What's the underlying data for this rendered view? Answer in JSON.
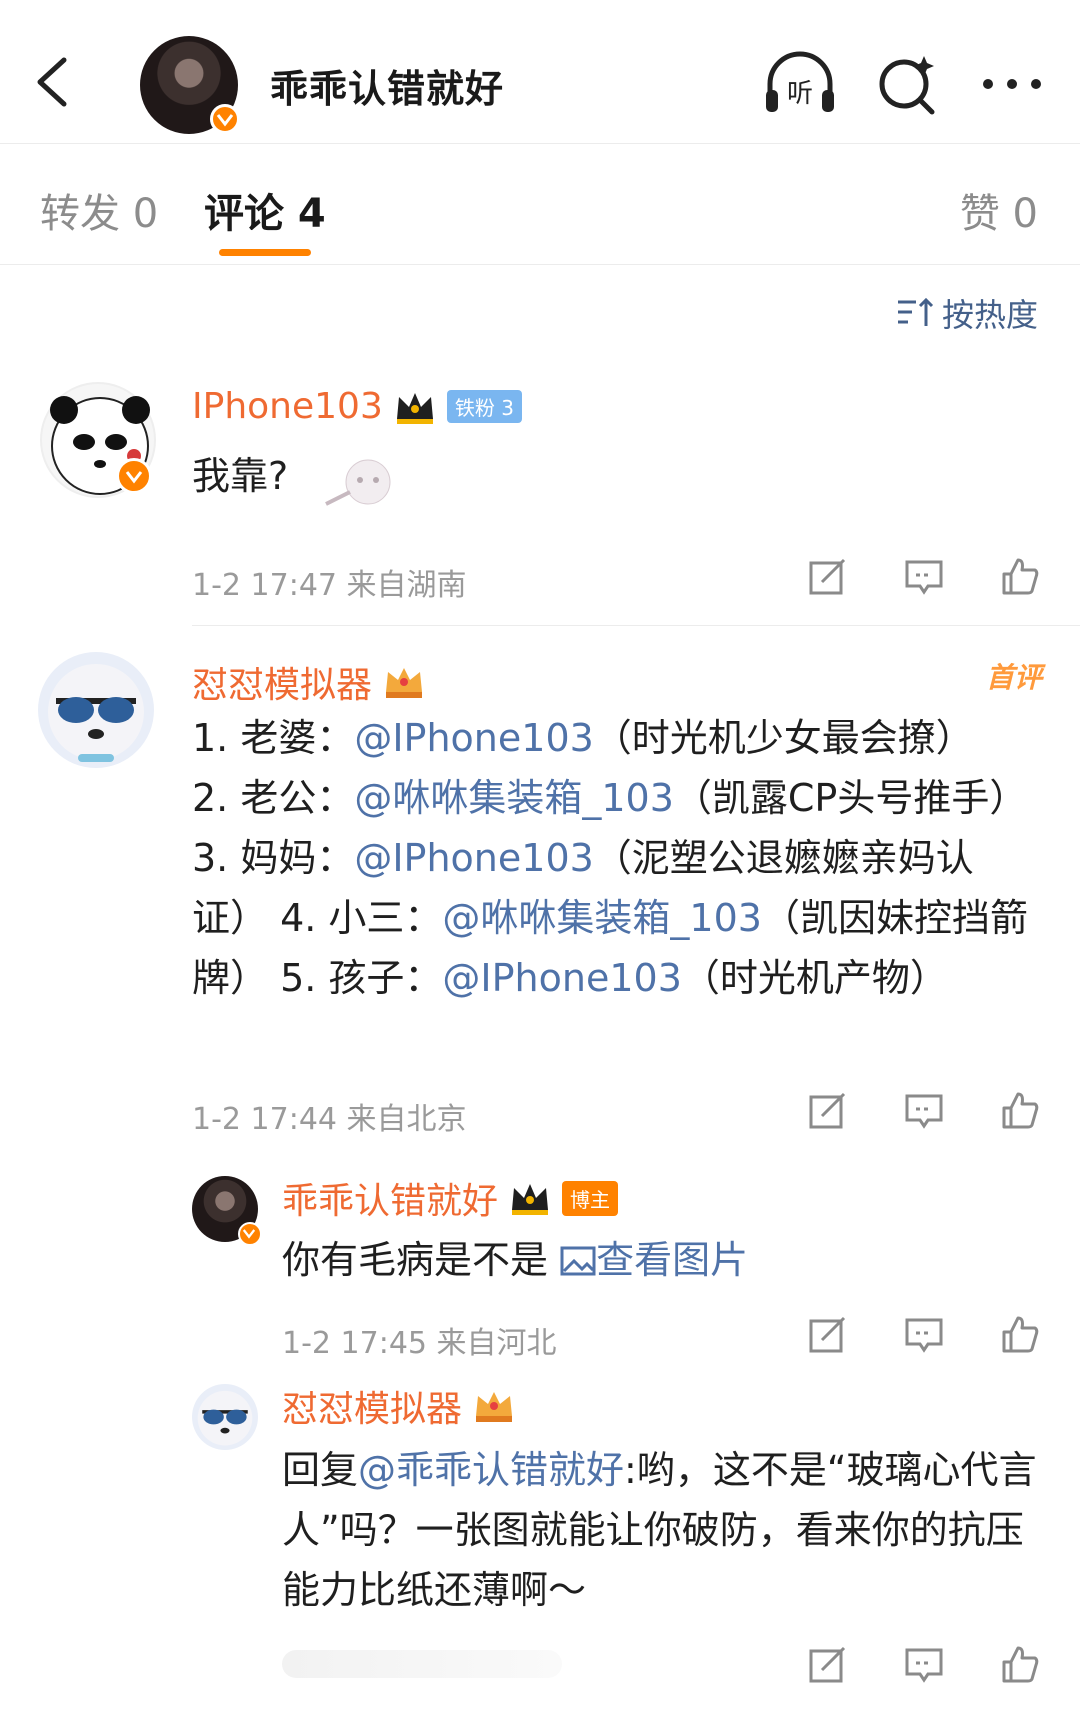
{
  "header": {
    "title": "乖乖认错就好"
  },
  "tabs": {
    "repost": "转发 0",
    "comment": "评论 4",
    "like": "赞 0"
  },
  "sort": {
    "label": "按热度"
  },
  "comments": [
    {
      "user": "IPhone103",
      "badge": "铁粉 3",
      "text": "我靠?",
      "meta": "1-2 17:47  来自湖南"
    },
    {
      "user": "怼怼模拟器",
      "tag": "首评",
      "text_parts": [
        "1. 老婆：",
        "@IPhone103",
        "（时光机少女最会撩）",
        "2. 老公：",
        "@咻咻集装箱_103",
        "（凯露CP头号推手）  3. 妈妈：",
        "@IPhone103",
        "（泥塑公退嬷嬷亲妈认证）  4. 小三：",
        "@咻咻集装箱_103",
        "（凯因妹控挡箭牌）  5. 孩子：",
        "@IPhone103",
        "（时光机产物）"
      ],
      "meta": "1-2 17:44  来自北京",
      "replies": [
        {
          "user": "乖乖认错就好",
          "badge": "博主",
          "text": "你有毛病是不是",
          "image_link": "查看图片",
          "meta": "1-2 17:45  来自河北"
        },
        {
          "user": "怼怼模拟器",
          "reply_prefix": "回复",
          "reply_to": "@乖乖认错就好",
          "text": ":哟，这不是“玻璃心代言人”吗？一张图就能让你破防，看来你的抗压能力比纸还薄啊～"
        }
      ]
    }
  ],
  "icons": [
    "back-icon",
    "listen-icon",
    "search-icon",
    "more-icon",
    "sort-icon",
    "share-icon",
    "comment-icon",
    "like-icon",
    "verified-icon",
    "crown-icon"
  ],
  "colors": {
    "accent": "#ff8200",
    "username": "#ef6a32",
    "mention": "#4f72a8",
    "meta": "#9a9a9a"
  }
}
